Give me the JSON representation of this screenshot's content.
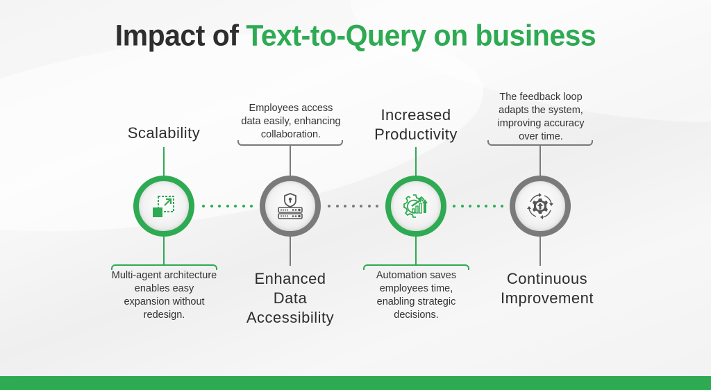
{
  "title": {
    "prefix": "Impact of ",
    "highlight": "Text-to-Query on business"
  },
  "colors": {
    "green": "#2eaa52",
    "gray": "#7a7a7a",
    "text": "#2e2e2e"
  },
  "items": [
    {
      "label": "Scalability",
      "description": "Multi-agent architecture enables easy expansion without redesign.",
      "icon": "expand-scale-icon",
      "theme": "green"
    },
    {
      "label": "Enhanced Data Accessibility",
      "description": "Employees access data easily, enhancing collaboration.",
      "icon": "secure-server-icon",
      "theme": "gray"
    },
    {
      "label": "Increased Productivity",
      "description": "Automation saves employees time, enabling strategic decisions.",
      "icon": "gear-growth-chart-icon",
      "theme": "green"
    },
    {
      "label": "Continuous Improvement",
      "description": "The feedback loop adapts the system, improving accuracy over time.",
      "icon": "gear-cycle-icon",
      "theme": "gray"
    }
  ]
}
